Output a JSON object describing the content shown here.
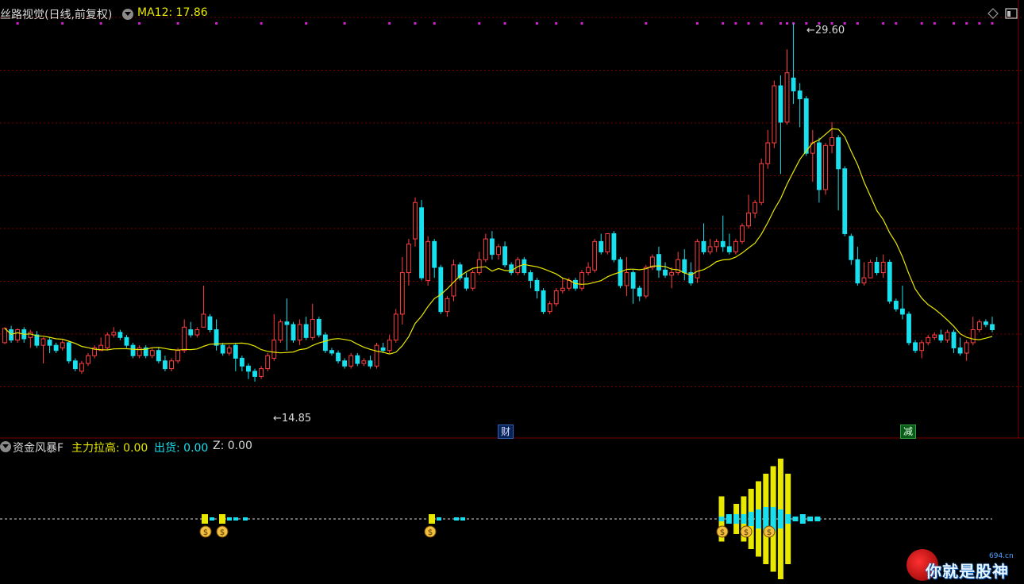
{
  "header": {
    "title": "丝路视觉(日线,前复权)",
    "ma_label": "MA12: 17.86",
    "ma_color": "#e8e800"
  },
  "indicator": {
    "name": "资金风暴F",
    "main_label": "主力拉高: 0.00",
    "main_color": "#e8e800",
    "ship_label": "出货: 0.00",
    "ship_color": "#18e0ee",
    "z_label": "Z: 0.00"
  },
  "marks": {
    "high_label": "29.60",
    "low_label": "14.85",
    "event_finance": "财",
    "event_reduce": "减"
  },
  "watermark": {
    "brand": "你就是股神",
    "site": "694.cn"
  },
  "colors": {
    "up": "#ff4040",
    "down": "#18e0ee",
    "ma": "#e8e800",
    "signal_dot": "#d020d0",
    "grid": "#7a0000"
  },
  "icons": [
    "collapse-icon",
    "diamond-icon",
    "window-icon",
    "money-bag-icon",
    "arrow-left-icon"
  ],
  "chart_data": [
    {
      "type": "candlestick",
      "title": "丝路视觉(日线,前复权)",
      "series_colors": {
        "up": "#ff4040",
        "down": "#18e0ee"
      },
      "ohlc": [
        [
          17.3,
          17.85,
          17.9,
          17.25
        ],
        [
          17.8,
          17.4,
          17.95,
          17.3
        ],
        [
          17.4,
          17.8,
          17.85,
          17.3
        ],
        [
          17.8,
          17.45,
          17.9,
          17.3
        ],
        [
          17.5,
          17.7,
          17.8,
          17.1
        ],
        [
          17.6,
          17.2,
          17.75,
          17.1
        ],
        [
          17.2,
          17.45,
          17.5,
          16.5
        ],
        [
          17.4,
          17.2,
          17.5,
          16.9
        ],
        [
          17.2,
          17.0,
          17.3,
          16.9
        ],
        [
          17.1,
          17.3,
          17.4,
          17.0
        ],
        [
          17.3,
          16.6,
          17.35,
          16.5
        ],
        [
          16.6,
          16.3,
          16.7,
          16.2
        ],
        [
          16.2,
          16.5,
          16.6,
          16.1
        ],
        [
          16.5,
          16.8,
          16.9,
          16.4
        ],
        [
          16.8,
          17.1,
          17.2,
          16.7
        ],
        [
          17.0,
          17.2,
          17.5,
          17.0
        ],
        [
          17.1,
          17.6,
          17.7,
          17.0
        ],
        [
          17.6,
          17.7,
          17.9,
          17.5
        ],
        [
          17.7,
          17.5,
          17.8,
          17.4
        ],
        [
          17.5,
          17.2,
          17.6,
          17.1
        ],
        [
          17.2,
          16.8,
          17.3,
          16.7
        ],
        [
          16.8,
          17.1,
          17.2,
          16.7
        ],
        [
          17.1,
          16.8,
          17.2,
          16.7
        ],
        [
          16.8,
          17.0,
          17.1,
          16.7
        ],
        [
          17.0,
          16.6,
          17.1,
          16.5
        ],
        [
          16.6,
          16.3,
          16.8,
          16.2
        ],
        [
          16.3,
          16.6,
          16.7,
          16.2
        ],
        [
          16.6,
          17.0,
          17.1,
          16.5
        ],
        [
          17.0,
          17.9,
          18.2,
          16.9
        ],
        [
          17.8,
          17.6,
          18.1,
          17.5
        ],
        [
          17.6,
          17.8,
          17.9,
          17.5
        ],
        [
          17.9,
          18.4,
          19.5,
          17.9
        ],
        [
          18.3,
          17.8,
          18.4,
          17.7
        ],
        [
          17.8,
          17.2,
          18.2,
          17.0
        ],
        [
          17.2,
          16.9,
          17.3,
          16.8
        ],
        [
          16.9,
          17.1,
          17.2,
          16.8
        ],
        [
          17.2,
          16.7,
          17.3,
          16.2
        ],
        [
          16.7,
          16.4,
          16.8,
          16.2
        ],
        [
          16.4,
          16.2,
          16.5,
          15.9
        ],
        [
          16.2,
          16.0,
          16.3,
          15.8
        ],
        [
          16.0,
          16.3,
          16.4,
          15.9
        ],
        [
          16.3,
          16.8,
          16.9,
          16.2
        ],
        [
          16.7,
          17.4,
          18.4,
          16.6
        ],
        [
          17.4,
          18.1,
          18.2,
          17.3
        ],
        [
          18.1,
          18.0,
          19.0,
          17.0
        ],
        [
          18.0,
          17.4,
          18.1,
          17.3
        ],
        [
          17.4,
          18.0,
          18.2,
          17.2
        ],
        [
          18.0,
          17.5,
          18.3,
          17.4
        ],
        [
          17.5,
          18.2,
          18.8,
          17.4
        ],
        [
          18.2,
          17.6,
          18.3,
          17.5
        ],
        [
          17.6,
          17.0,
          17.7,
          16.9
        ],
        [
          17.0,
          16.9,
          17.1,
          16.8
        ],
        [
          16.9,
          16.6,
          17.0,
          16.5
        ],
        [
          16.6,
          16.4,
          16.7,
          16.3
        ],
        [
          16.4,
          16.8,
          16.9,
          16.3
        ],
        [
          16.8,
          16.5,
          16.9,
          16.4
        ],
        [
          16.5,
          16.6,
          16.7,
          16.4
        ],
        [
          16.6,
          16.4,
          16.8,
          16.3
        ],
        [
          16.4,
          17.2,
          17.3,
          16.3
        ],
        [
          17.1,
          17.0,
          17.3,
          16.9
        ],
        [
          17.0,
          17.4,
          17.6,
          16.9
        ],
        [
          17.4,
          18.4,
          18.6,
          17.3
        ],
        [
          18.4,
          20.0,
          20.6,
          18.0
        ],
        [
          20.0,
          21.1,
          21.3,
          19.5
        ],
        [
          21.3,
          22.7,
          22.9,
          21.0
        ],
        [
          22.5,
          19.8,
          22.8,
          19.7
        ],
        [
          19.7,
          21.2,
          21.4,
          19.5
        ],
        [
          21.2,
          20.2,
          21.3,
          19.8
        ],
        [
          20.2,
          18.5,
          20.3,
          18.4
        ],
        [
          18.5,
          19.0,
          19.1,
          18.3
        ],
        [
          19.1,
          20.3,
          20.5,
          18.9
        ],
        [
          20.3,
          19.8,
          20.4,
          19.7
        ],
        [
          19.8,
          19.4,
          20.0,
          19.3
        ],
        [
          19.4,
          20.0,
          20.1,
          19.3
        ],
        [
          20.0,
          20.5,
          20.8,
          19.9
        ],
        [
          20.5,
          21.3,
          21.5,
          20.4
        ],
        [
          21.3,
          20.7,
          21.6,
          20.5
        ],
        [
          20.7,
          21.0,
          21.1,
          20.5
        ],
        [
          21.0,
          20.3,
          21.2,
          20.2
        ],
        [
          20.3,
          20.0,
          20.4,
          19.9
        ],
        [
          20.0,
          20.5,
          20.6,
          19.9
        ],
        [
          20.5,
          20.0,
          20.6,
          19.9
        ],
        [
          20.0,
          19.7,
          20.1,
          19.4
        ],
        [
          19.7,
          19.3,
          19.8,
          19.0
        ],
        [
          19.3,
          18.5,
          19.4,
          18.4
        ],
        [
          18.5,
          18.8,
          18.9,
          18.4
        ],
        [
          18.8,
          19.3,
          19.4,
          18.7
        ],
        [
          19.3,
          19.4,
          19.8,
          19.2
        ],
        [
          19.4,
          19.7,
          19.8,
          19.3
        ],
        [
          19.7,
          19.4,
          19.8,
          19.3
        ],
        [
          19.4,
          20.0,
          20.1,
          19.3
        ],
        [
          20.0,
          20.2,
          20.4,
          19.9
        ],
        [
          20.1,
          21.2,
          21.3,
          20.0
        ],
        [
          21.2,
          20.8,
          21.5,
          20.7
        ],
        [
          20.8,
          21.5,
          21.5,
          20.7
        ],
        [
          21.5,
          20.5,
          21.6,
          20.4
        ],
        [
          20.5,
          19.5,
          20.6,
          19.4
        ],
        [
          19.5,
          20.0,
          20.6,
          19.1
        ],
        [
          20.0,
          19.4,
          20.1,
          18.8
        ],
        [
          19.4,
          19.1,
          19.5,
          18.9
        ],
        [
          19.1,
          20.2,
          20.3,
          19.0
        ],
        [
          20.2,
          20.6,
          20.7,
          20.1
        ],
        [
          20.7,
          20.1,
          21.0,
          19.8
        ],
        [
          20.1,
          19.9,
          20.4,
          19.8
        ],
        [
          19.9,
          20.0,
          20.2,
          19.4
        ],
        [
          20.0,
          20.5,
          20.8,
          19.9
        ],
        [
          20.5,
          20.0,
          20.9,
          19.7
        ],
        [
          20.0,
          19.6,
          20.4,
          19.5
        ],
        [
          19.8,
          21.2,
          21.3,
          19.6
        ],
        [
          21.2,
          20.8,
          21.9,
          20.7
        ],
        [
          20.8,
          21.0,
          21.3,
          20.7
        ],
        [
          21.0,
          21.2,
          21.3,
          20.8
        ],
        [
          21.2,
          21.0,
          22.2,
          20.8
        ],
        [
          21.0,
          20.8,
          21.5,
          20.7
        ],
        [
          20.8,
          21.2,
          21.3,
          20.7
        ],
        [
          21.2,
          21.8,
          21.9,
          21.1
        ],
        [
          21.8,
          22.3,
          23.0,
          21.7
        ],
        [
          22.3,
          22.7,
          22.8,
          22.1
        ],
        [
          22.7,
          24.2,
          24.4,
          22.6
        ],
        [
          24.2,
          25.0,
          25.5,
          24.0
        ],
        [
          25.0,
          27.2,
          27.4,
          24.8
        ],
        [
          27.2,
          25.8,
          27.6,
          23.8
        ],
        [
          25.8,
          27.7,
          28.6,
          25.7
        ],
        [
          27.5,
          27.0,
          29.6,
          26.5
        ],
        [
          27.0,
          26.7,
          27.3,
          25.6
        ],
        [
          26.7,
          24.6,
          26.8,
          24.5
        ],
        [
          24.6,
          25.0,
          25.5,
          23.5
        ],
        [
          25.0,
          23.2,
          25.2,
          22.7
        ],
        [
          23.2,
          24.9,
          25.0,
          23.0
        ],
        [
          24.9,
          25.2,
          25.8,
          24.6
        ],
        [
          25.2,
          24.0,
          25.3,
          22.4
        ],
        [
          24.0,
          21.5,
          24.1,
          21.4
        ],
        [
          21.4,
          20.5,
          21.5,
          20.3
        ],
        [
          20.5,
          19.6,
          21.0,
          19.5
        ],
        [
          19.6,
          19.8,
          20.4,
          19.5
        ],
        [
          19.8,
          20.4,
          20.5,
          19.8
        ],
        [
          20.4,
          20.0,
          20.6,
          19.9
        ],
        [
          20.0,
          20.4,
          20.7,
          19.8
        ],
        [
          20.4,
          18.9,
          20.5,
          18.8
        ],
        [
          18.9,
          18.6,
          19.0,
          18.5
        ],
        [
          18.6,
          18.4,
          19.5,
          18.2
        ],
        [
          18.4,
          17.3,
          18.5,
          17.2
        ],
        [
          17.3,
          17.0,
          17.4,
          16.9
        ],
        [
          17.0,
          17.3,
          17.4,
          16.7
        ],
        [
          17.3,
          17.5,
          17.6,
          17.2
        ],
        [
          17.5,
          17.6,
          17.7,
          17.4
        ],
        [
          17.6,
          17.4,
          17.8,
          17.3
        ],
        [
          17.4,
          17.7,
          17.8,
          17.3
        ],
        [
          17.7,
          17.1,
          17.8,
          16.9
        ],
        [
          17.1,
          16.9,
          17.5,
          16.8
        ],
        [
          16.9,
          17.3,
          17.4,
          16.6
        ],
        [
          17.3,
          17.8,
          18.3,
          17.2
        ],
        [
          17.8,
          18.1,
          18.2,
          17.7
        ],
        [
          18.1,
          18.0,
          18.2,
          17.9
        ],
        [
          18.0,
          17.8,
          18.3,
          17.7
        ]
      ],
      "high_label": "29.60",
      "low_label": "14.85",
      "events": [
        "财",
        "减"
      ]
    },
    {
      "type": "bar",
      "title": "资金风暴F",
      "series": [
        {
          "name": "主力拉高",
          "values": [
            0,
            0,
            1,
            1,
            0,
            0,
            1,
            0,
            0,
            0,
            3,
            0,
            2,
            3,
            4,
            5,
            6,
            7,
            8,
            6
          ]
        },
        {
          "name": "出货",
          "values": [
            0,
            0,
            1,
            2,
            1,
            1,
            1,
            2,
            1,
            0,
            1,
            2,
            2,
            2,
            3,
            4,
            5,
            5,
            4,
            2
          ]
        },
        {
          "name": "Z",
          "values": [
            0,
            0,
            0,
            0,
            0,
            0,
            0,
            0,
            0,
            0,
            0,
            0,
            0,
            0,
            0,
            0,
            0,
            0,
            0,
            0
          ]
        }
      ]
    }
  ]
}
